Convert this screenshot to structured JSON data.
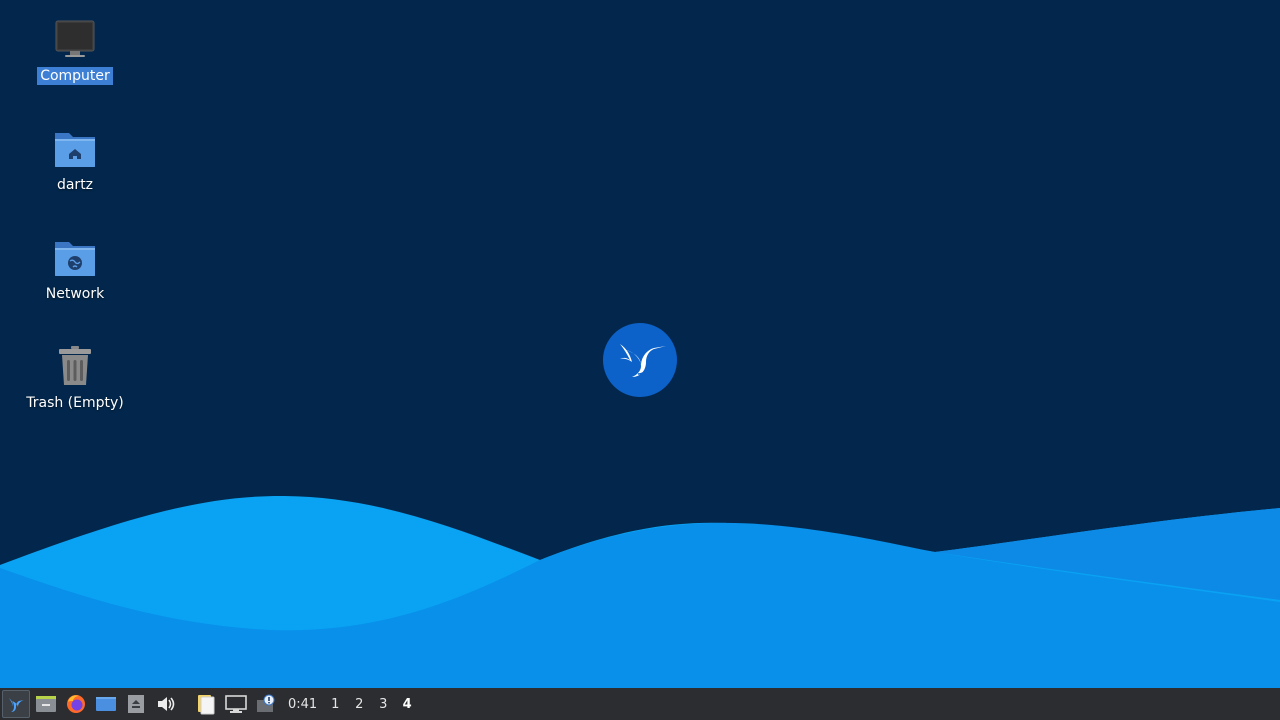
{
  "desktop": {
    "icons": [
      {
        "label": "Computer",
        "icon": "computer-icon",
        "selected": true
      },
      {
        "label": "dartz",
        "icon": "home-folder-icon"
      },
      {
        "label": "Network",
        "icon": "network-folder-icon"
      },
      {
        "label": "Trash (Empty)",
        "icon": "trash-icon"
      }
    ],
    "background_color": "#03274c",
    "wave_colors": [
      "#0aa0f0",
      "#0a8ee8",
      "#0077e0"
    ],
    "logo": "hummingbird-logo-icon"
  },
  "taskbar": {
    "launchers": [
      {
        "icon": "start-menu-hummingbird-icon"
      },
      {
        "icon": "file-manager-icon"
      },
      {
        "icon": "firefox-icon"
      },
      {
        "icon": "show-desktop-icon"
      },
      {
        "icon": "eject-icon"
      },
      {
        "icon": "volume-icon"
      }
    ],
    "tray": [
      {
        "icon": "clipboard-icon"
      },
      {
        "icon": "network-monitor-icon"
      },
      {
        "icon": "update-notifier-icon"
      }
    ],
    "clock": "0:41",
    "workspaces": [
      "1",
      "2",
      "3",
      "4"
    ],
    "current_workspace": "4"
  }
}
